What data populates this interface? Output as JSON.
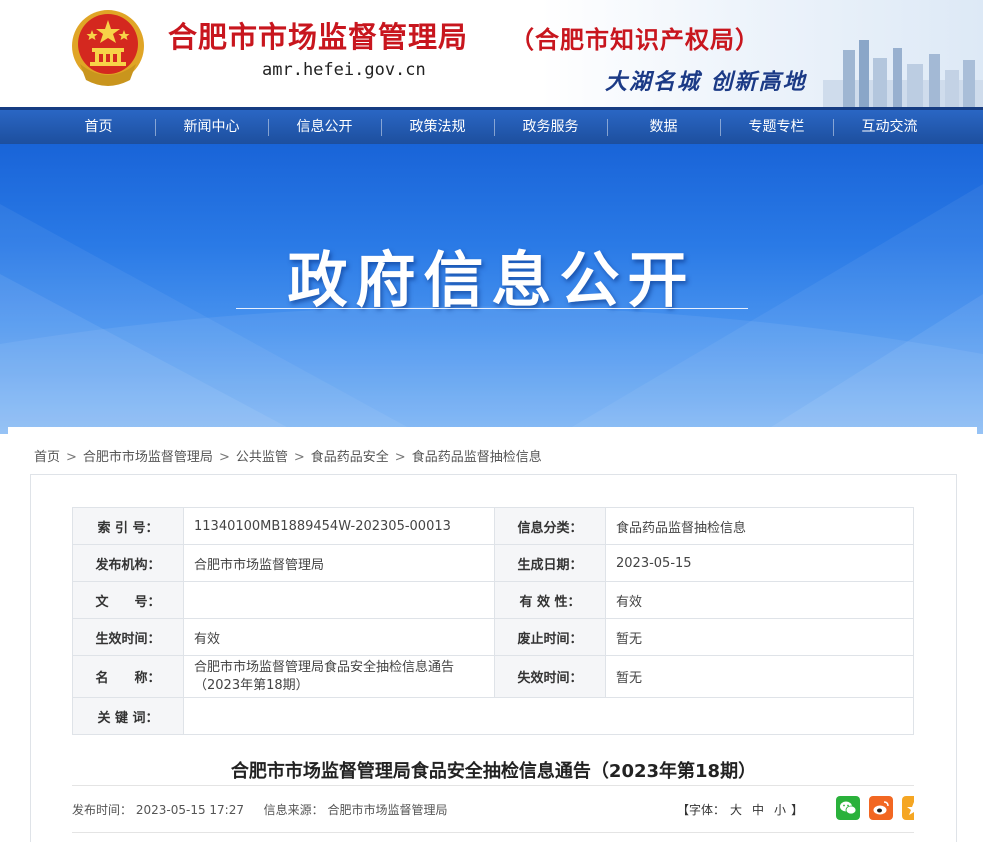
{
  "header": {
    "title": "合肥市市场监督管理局",
    "subtitle": "（合肥市知识产权局）",
    "domain": "amr.hefei.gov.cn",
    "slogan": "大湖名城  创新高地"
  },
  "nav": {
    "items": [
      "首页",
      "新闻中心",
      "信息公开",
      "政策法规",
      "政务服务",
      "数据",
      "专题专栏",
      "互动交流"
    ]
  },
  "banner": {
    "title": "政府信息公开"
  },
  "breadcrumb": [
    "首页",
    "合肥市市场监督管理局",
    "公共监管",
    "食品药品安全",
    "食品药品监督抽检信息"
  ],
  "meta": {
    "index_label": "索 引 号：",
    "index_value": "11340100MB1889454W-202305-00013",
    "category_label": "信息分类：",
    "category_value": "食品药品监督抽检信息",
    "publisher_label": "发布机构：",
    "publisher_value": "合肥市市场监督管理局",
    "gen_date_label": "生成日期：",
    "gen_date_value": "2023-05-15",
    "doc_no_label": "文　　号：",
    "doc_no_value": "",
    "validity_label": "有 效 性：",
    "validity_value": "有效",
    "effective_label": "生效时间：",
    "effective_value": "有效",
    "abolish_label": "废止时间：",
    "abolish_value": "暂无",
    "name_label": "名　　称：",
    "name_value": "合肥市市场监督管理局食品安全抽检信息通告（2023年第18期）",
    "expire_label": "失效时间：",
    "expire_value": "暂无",
    "keywords_label": "关 键 词：",
    "keywords_value": ""
  },
  "article": {
    "title": "合肥市市场监督管理局食品安全抽检信息通告（2023年第18期）",
    "publish_time_label": "发布时间：",
    "publish_time": "2023-05-15 17:27",
    "source_label": "信息来源：",
    "source": "合肥市市场监督管理局",
    "font_label": "【字体：",
    "font_large": "大",
    "font_medium": "中",
    "font_small": "小",
    "font_close": "】"
  },
  "share": {
    "icons": [
      "wechat-icon",
      "weibo-icon",
      "qzone-icon"
    ],
    "colors": {
      "wechat": "#2ab13b",
      "weibo": "#f26722",
      "qzone": "#f5a623"
    }
  },
  "colors": {
    "title_red": "#c8161e",
    "nav_blue": "#1d4f9e",
    "banner_blue": "#1964d8"
  }
}
